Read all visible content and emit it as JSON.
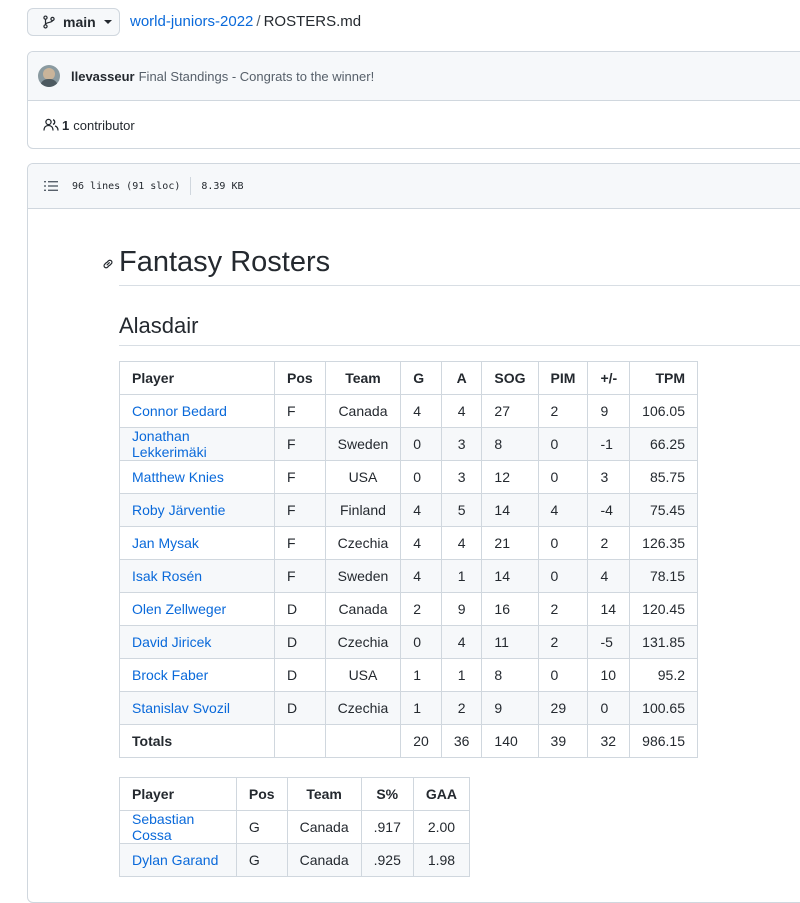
{
  "top": {
    "branch": "main",
    "repo": "world-juniors-2022",
    "separator": "/",
    "file": "ROSTERS.md"
  },
  "commit": {
    "author": "llevasseur",
    "message": "Final Standings - Congrats to the winner!"
  },
  "contributors": {
    "count": "1",
    "label": "contributor"
  },
  "file_info": {
    "lines": "96 lines (91 sloc)",
    "size": "8.39 KB"
  },
  "markdown": {
    "h1": "Fantasy Rosters",
    "h2": "Alasdair"
  },
  "skaters": {
    "headers": [
      "Player",
      "Pos",
      "Team",
      "G",
      "A",
      "SOG",
      "PIM",
      "+/-",
      "TPM"
    ],
    "rows": [
      [
        "Connor Bedard",
        "F",
        "Canada",
        "4",
        "4",
        "27",
        "2",
        "9",
        "106.05"
      ],
      [
        "Jonathan Lekkerimäki",
        "F",
        "Sweden",
        "0",
        "3",
        "8",
        "0",
        "-1",
        "66.25"
      ],
      [
        "Matthew Knies",
        "F",
        "USA",
        "0",
        "3",
        "12",
        "0",
        "3",
        "85.75"
      ],
      [
        "Roby Järventie",
        "F",
        "Finland",
        "4",
        "5",
        "14",
        "4",
        "-4",
        "75.45"
      ],
      [
        "Jan Mysak",
        "F",
        "Czechia",
        "4",
        "4",
        "21",
        "0",
        "2",
        "126.35"
      ],
      [
        "Isak Rosén",
        "F",
        "Sweden",
        "4",
        "1",
        "14",
        "0",
        "4",
        "78.15"
      ],
      [
        "Olen Zellweger",
        "D",
        "Canada",
        "2",
        "9",
        "16",
        "2",
        "14",
        "120.45"
      ],
      [
        "David Jiricek",
        "D",
        "Czechia",
        "0",
        "4",
        "11",
        "2",
        "-5",
        "131.85"
      ],
      [
        "Brock Faber",
        "D",
        "USA",
        "1",
        "1",
        "8",
        "0",
        "10",
        "95.2"
      ],
      [
        "Stanislav Svozil",
        "D",
        "Czechia",
        "1",
        "2",
        "9",
        "29",
        "0",
        "100.65"
      ]
    ],
    "totals": [
      "Totals",
      "",
      "",
      "20",
      "36",
      "140",
      "39",
      "32",
      "986.15"
    ]
  },
  "goalies": {
    "headers": [
      "Player",
      "Pos",
      "Team",
      "S%",
      "GAA"
    ],
    "rows": [
      [
        "Sebastian Cossa",
        "G",
        "Canada",
        ".917",
        "2.00"
      ],
      [
        "Dylan Garand",
        "G",
        "Canada",
        ".925",
        "1.98"
      ]
    ]
  },
  "colors": {
    "link": "#0969da",
    "border": "#d0d7de",
    "header_bg": "#f6f8fa"
  }
}
